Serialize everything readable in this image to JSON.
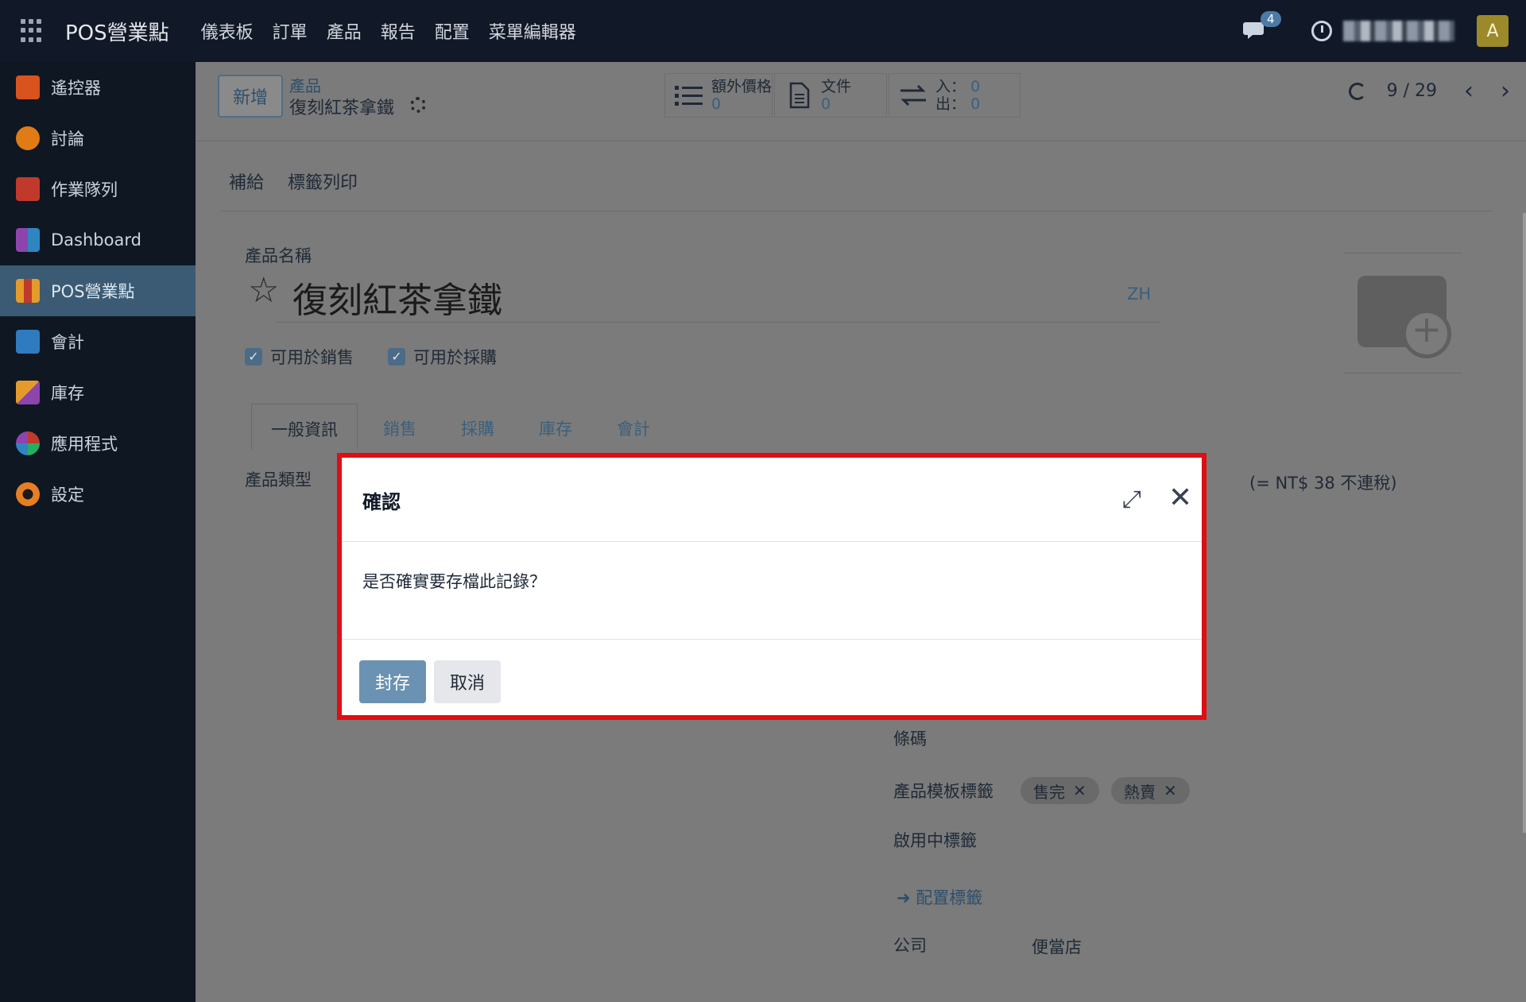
{
  "navbar": {
    "brand": "POS營業點",
    "menu": [
      "儀表板",
      "訂單",
      "產品",
      "報告",
      "配置",
      "菜單編輯器"
    ],
    "chat_count": "4",
    "avatar_letter": "A"
  },
  "sidebar": {
    "items": [
      {
        "label": "遙控器",
        "icon": "remote-control-icon",
        "color": "#d9531e"
      },
      {
        "label": "討論",
        "icon": "discuss-icon",
        "color": "#e07b16"
      },
      {
        "label": "作業隊列",
        "icon": "job-queue-icon",
        "color": "#c0392b"
      },
      {
        "label": "Dashboard",
        "icon": "dashboard-icon",
        "color": "#8e44ad"
      },
      {
        "label": "POS營業點",
        "icon": "pos-icon",
        "color": "#e39b2b"
      },
      {
        "label": "會計",
        "icon": "accounting-icon",
        "color": "#2f7bbf"
      },
      {
        "label": "庫存",
        "icon": "inventory-icon",
        "color": "#c0622b"
      },
      {
        "label": "應用程式",
        "icon": "apps-icon",
        "color": "#27ae60"
      },
      {
        "label": "設定",
        "icon": "settings-icon",
        "color": "#e67e22"
      }
    ]
  },
  "controlbar": {
    "new_label": "新增",
    "breadcrumb_parent": "產品",
    "breadcrumb_current": "復刻紅茶拿鐵",
    "stats": {
      "extra_price": {
        "label": "額外價格",
        "value": "0"
      },
      "documents": {
        "label": "文件",
        "value": "0"
      },
      "moves_in": {
        "label": "入：",
        "value": "0"
      },
      "moves_out": {
        "label": "出：",
        "value": "0"
      }
    },
    "pager": "9 / 29"
  },
  "form": {
    "actions": [
      "補給",
      "標籤列印"
    ],
    "product_name_label": "產品名稱",
    "product_name": "復刻紅茶拿鐵",
    "lang": "ZH",
    "sale_ok_label": "可用於銷售",
    "purchase_ok_label": "可用於採購",
    "tabs": [
      "一般資訊",
      "銷售",
      "採購",
      "庫存",
      "會計"
    ],
    "product_type_label": "產品類型",
    "price_note": "(= NT$ 38 不連稅)",
    "barcode_label": "條碼",
    "template_tags_label": "產品模板標籤",
    "tags": [
      "售完",
      "熱賣"
    ],
    "active_tags_label": "啟用中標籤",
    "configure_tags_link": "配置標籤",
    "company_label": "公司",
    "company_value": "便當店"
  },
  "modal": {
    "title": "確認",
    "body": "是否確實要存檔此記錄？",
    "archive_label": "封存",
    "cancel_label": "取消"
  }
}
